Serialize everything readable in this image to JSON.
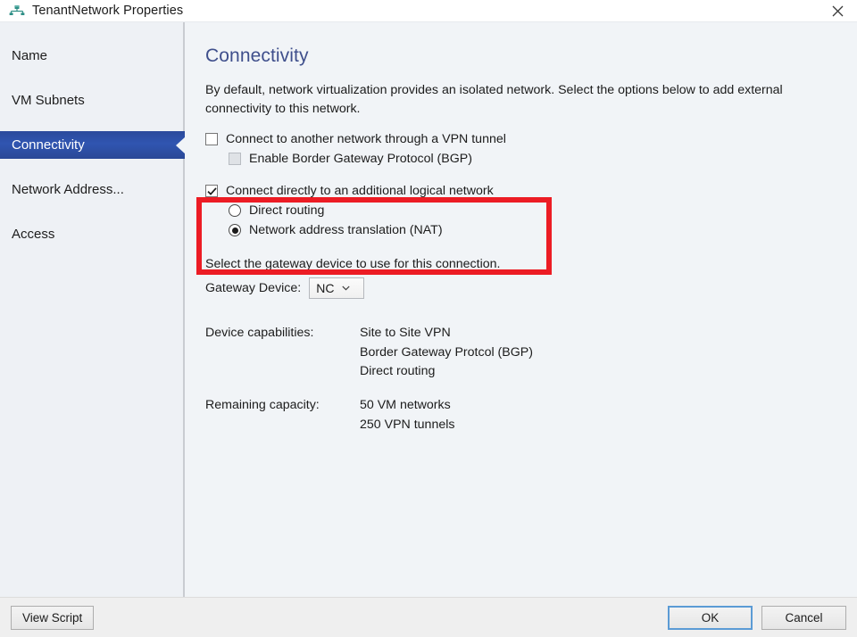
{
  "window": {
    "title": "TenantNetwork Properties",
    "icon": "network-adapter-icon",
    "close_label": "✕"
  },
  "sidebar": {
    "items": [
      {
        "label": "Name",
        "selected": false
      },
      {
        "label": "VM Subnets",
        "selected": false
      },
      {
        "label": "Connectivity",
        "selected": true
      },
      {
        "label": "Network Address...",
        "selected": false
      },
      {
        "label": "Access",
        "selected": false
      }
    ]
  },
  "content": {
    "page_title": "Connectivity",
    "intro": "By default, network virtualization provides an isolated network. Select the options below to add external connectivity to this network.",
    "options": {
      "vpn_tunnel": {
        "label": "Connect to another network through a VPN tunnel",
        "checked": false
      },
      "bgp": {
        "label": "Enable Border Gateway Protocol (BGP)",
        "checked": false,
        "disabled": true
      },
      "additional_logical_network": {
        "label": "Connect directly to an additional logical network",
        "checked": true
      },
      "direct_routing": {
        "label": "Direct routing",
        "selected": false
      },
      "nat": {
        "label": "Network address translation (NAT)",
        "selected": true
      }
    },
    "gateway": {
      "note": "Select the gateway device to use for this connection.",
      "label": "Gateway Device:",
      "value": "NC",
      "arrow": "⌄"
    },
    "capabilities": {
      "key": "Device capabilities:",
      "values": [
        "Site to Site VPN",
        "Border Gateway Protcol (BGP)",
        "Direct routing"
      ]
    },
    "remaining_capacity": {
      "key": "Remaining capacity:",
      "values": [
        "50 VM networks",
        "250 VPN tunnels"
      ]
    }
  },
  "footer": {
    "view_script_label": "View Script",
    "ok_label": "OK",
    "cancel_label": "Cancel"
  },
  "colors": {
    "accent_selected": "#2f52a8",
    "heading": "#3f4f8c",
    "annotation_red": "#ec1c24",
    "sidebar_bg": "#eef1f5",
    "content_bg": "#f1f4f7"
  }
}
